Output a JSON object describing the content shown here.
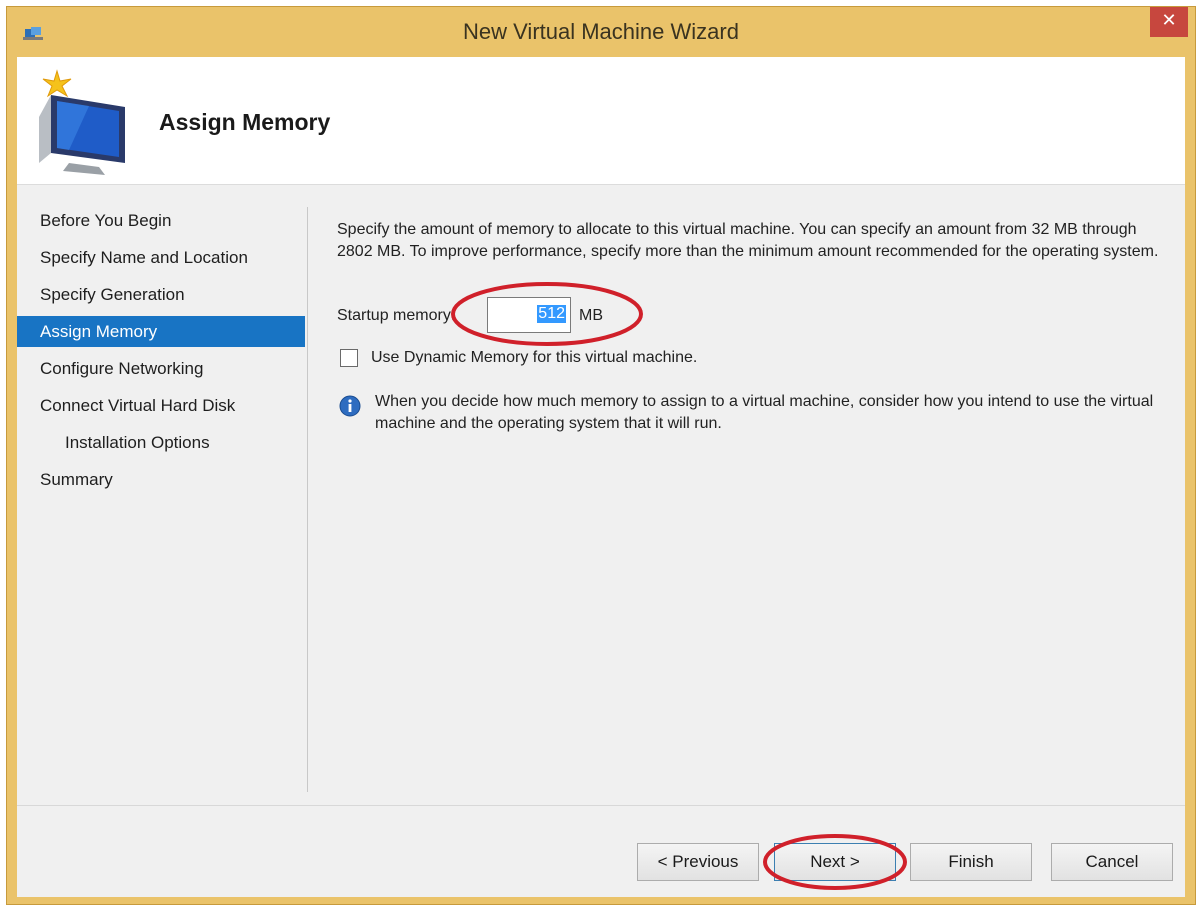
{
  "window": {
    "title": "New Virtual Machine Wizard",
    "close_glyph": "✕"
  },
  "header": {
    "title": "Assign Memory"
  },
  "nav": {
    "items": [
      {
        "label": "Before You Begin"
      },
      {
        "label": "Specify Name and Location"
      },
      {
        "label": "Specify Generation"
      },
      {
        "label": "Assign Memory"
      },
      {
        "label": "Configure Networking"
      },
      {
        "label": "Connect Virtual Hard Disk"
      },
      {
        "label": "Installation Options"
      },
      {
        "label": "Summary"
      }
    ],
    "selected_label": "Assign Memory"
  },
  "content": {
    "description": "Specify the amount of memory to allocate to this virtual machine. You can specify an amount from 32 MB through 2802 MB. To improve performance, specify more than the minimum amount recommended for the operating system.",
    "startup_memory_label": "Startup memory:",
    "startup_memory_value": "512",
    "startup_memory_unit": "MB",
    "dynamic_memory_label": "Use Dynamic Memory for this virtual machine.",
    "dynamic_memory_checked": false,
    "info_text": "When you decide how much memory to assign to a virtual machine, consider how you intend to use the virtual machine and the operating system that it will run."
  },
  "buttons": {
    "previous": "< Previous",
    "next": "Next >",
    "finish": "Finish",
    "cancel": "Cancel"
  },
  "colors": {
    "accent": "#1874c4",
    "annotation": "#d0202a",
    "window_frame": "#eac36a"
  },
  "icons": {
    "app": "hyper-v-icon",
    "header": "computer-monitor-star-icon",
    "info": "info-icon",
    "close": "close-icon"
  }
}
